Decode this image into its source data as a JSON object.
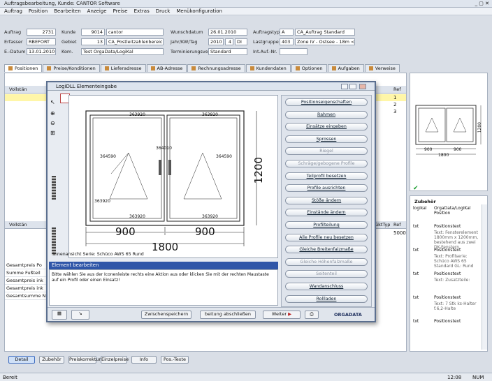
{
  "window": {
    "title": "Auftragsbearbeitung, Kunde: CANTOR Software"
  },
  "menu": [
    "Auftrag",
    "Position",
    "Bearbeiten",
    "Anzeige",
    "Preise",
    "Extras",
    "Druck",
    "Menükonfiguration"
  ],
  "header": {
    "auftrag_label": "Auftrag",
    "auftrag_value": "2731",
    "kunde_label": "Kunde",
    "kunde_value": "9014",
    "kunde_name": "cantor",
    "wunschdatum_label": "Wunschdatum",
    "wunschdatum_value": "26.01.2010",
    "auftragstyp_label": "Auftragstyp",
    "auftragstyp_code": "A",
    "auftragstyp_value": "CA_Auftrag Standard",
    "erfasser_label": "Erfasser",
    "erfasser_value": "RBEFORT",
    "gebiet_label": "Gebiet",
    "gebiet_value": "13",
    "gebiet_name": "CA_Postleitzahlenbereich 3...",
    "jahr_label": "Jahr/KW/Tag",
    "jahr_value": "2010",
    "kw_value": "4",
    "tag_value": "DI",
    "lastgruppe_label": "Lastgruppe",
    "lastgruppe_code": "403",
    "lastgruppe_value": "Zone IV - Ostsee - 18m < Höhe",
    "edatum_label": "E.-Datum",
    "edatum_value": "13.01.2010",
    "kom_label": "Kom.",
    "kom_value": "Test OrgaData/LogiKal",
    "termin_label": "Terminierungsverf.",
    "termin_value": "Standard",
    "intauf_label": "Int.Auf.-Nr.",
    "intauf_value": ""
  },
  "tabs": [
    "Positionen",
    "Preise/Konditionen",
    "Lieferadresse",
    "AB-Adresse",
    "Rechnungsadresse",
    "Kundendaten",
    "Optionen",
    "Aufgaben",
    "Verweise"
  ],
  "grid": {
    "col1": "Vollstän",
    "col_right": "Ref",
    "rows_right": [
      "1",
      "2",
      "3"
    ],
    "col_right2": "Ref",
    "row_right2": "5000",
    "col_mid": "üktTyp",
    "lower_col": "Vollstän"
  },
  "summary": [
    "Gesamtpreis Po",
    "Summe Fußteil",
    "Gesamtpreis ink",
    "Gesamtpreis ink",
    "Gesamtsumme N"
  ],
  "bottom_buttons": [
    "Detail",
    "Zubehör",
    "Preiskorrektur",
    "Einzelpreise",
    "Info",
    "Pos.-Texte"
  ],
  "status": {
    "left": "Bereit",
    "time": "12:08",
    "mode": "NUM"
  },
  "dialog": {
    "title": "LogiDLL Elementeingabe",
    "caption": "Innenansicht   Serie: Schüco AWS 65 Rund",
    "info_title": "Element bearbeiten",
    "info_text": "Bitte wählen Sie aus der Iconenleiste rechts eine Aktion aus oder klicken Sie mit der rechten Maustaste auf ein Profil oder einen Einsatz!",
    "buttons": [
      {
        "label": "Positionseigenschaften",
        "enabled": true
      },
      {
        "label": "Rahmen",
        "enabled": true
      },
      {
        "label": "Einsätze eingeben",
        "enabled": true
      },
      {
        "label": "Sprossen",
        "enabled": true
      },
      {
        "label": "Riegel",
        "enabled": false
      },
      {
        "label": "Schräge/gebogene Profile",
        "enabled": false
      },
      {
        "label": "Teilprofil besetzen",
        "enabled": true
      },
      {
        "label": "Profile ausrichten",
        "enabled": true
      },
      {
        "label": "Stöße ändern",
        "enabled": true
      },
      {
        "label": "Einstände ändern",
        "enabled": true
      },
      {
        "label": "Profilteilung",
        "enabled": true
      },
      {
        "label": "Alle Profile neu besetzen",
        "enabled": true
      },
      {
        "label": "Gleiche Breitenfalzmaße",
        "enabled": true
      },
      {
        "label": "Gleiche Höhenfalzmaße",
        "enabled": false
      },
      {
        "label": "Seitenteil",
        "enabled": false
      },
      {
        "label": "Wandanschluss",
        "enabled": true
      },
      {
        "label": "Rollladen",
        "enabled": true
      }
    ],
    "footer": {
      "zwischen": "Zwischenspeichern",
      "abschliessen": "beitung abschließen",
      "weiter": "Weiter",
      "logo": "ORGADATA"
    },
    "drawing": {
      "w_left": "900",
      "w_right": "900",
      "w_total": "1800",
      "h_total": "1200",
      "p_top_left": "363920",
      "p_top_right": "363920",
      "p_bot_left": "363920",
      "p_bot_right": "363920",
      "p_side_left": "363920",
      "p_mid": "364010",
      "p_sash_left": "364590",
      "p_sash_right": "364590"
    }
  },
  "preview": {
    "w_left": "900",
    "w_right": "900",
    "w_total": "1800",
    "h_total": "1200"
  },
  "zubehoer": {
    "title": "Zubehör",
    "rows": [
      {
        "k": "logikal",
        "v": "OrgaData/LogiKal Position",
        "sub": ""
      },
      {
        "k": "txt",
        "v": "Positionstext",
        "sub": "Text: Fensterelement 1800mm x 1200mm, bestehend aus zwei DK-Fenstern."
      },
      {
        "k": "txt",
        "v": "Positionstext",
        "sub": "Text: Profilserie: Schüco AWS 65 Standard GL: Rund"
      },
      {
        "k": "txt",
        "v": "Positionstext",
        "sub": "Text: Zusatzteile:"
      },
      {
        "k": "txt",
        "v": "Positionstext",
        "sub": "Text: 7 Stk ks-Halter f.6,2-Halte"
      },
      {
        "k": "txt",
        "v": "Positionstext",
        "sub": ""
      }
    ]
  }
}
